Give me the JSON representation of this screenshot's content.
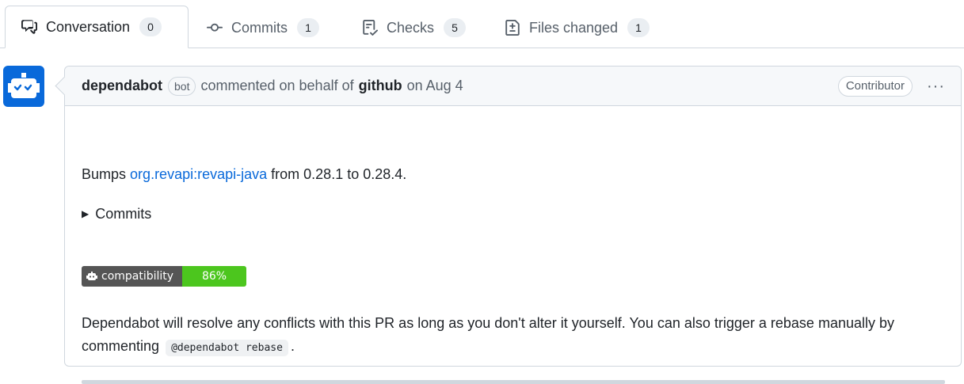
{
  "tabs": [
    {
      "label": "Conversation",
      "count": "0",
      "icon": "comment-discussion-icon"
    },
    {
      "label": "Commits",
      "count": "1",
      "icon": "git-commit-icon"
    },
    {
      "label": "Checks",
      "count": "5",
      "icon": "checklist-icon"
    },
    {
      "label": "Files changed",
      "count": "1",
      "icon": "file-diff-icon"
    }
  ],
  "comment": {
    "author": "dependabot",
    "bot_label": "bot",
    "action": "commented on behalf of",
    "org": "github",
    "date": "on Aug 4",
    "role_badge": "Contributor",
    "menu": "···",
    "avatar_icon": "dependabot-robot-icon",
    "body": {
      "bumps_prefix": "Bumps",
      "package": "org.revapi:revapi-java",
      "bumps_suffix": "from 0.28.1 to 0.28.4.",
      "commits_toggle": "Commits",
      "badge_label": "compatibility",
      "badge_value": "86%",
      "paragraph_part1": "Dependabot will resolve any conflicts with this PR as long as you don't alter it yourself. You can also trigger a rebase manually by commenting",
      "rebase_command": "@dependabot rebase",
      "paragraph_end": "."
    }
  },
  "colors": {
    "accent": "#0969da",
    "badge_green": "#4cc61e",
    "badge_gray": "#555555"
  }
}
